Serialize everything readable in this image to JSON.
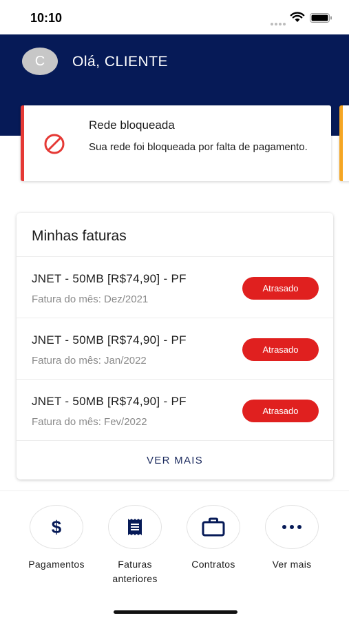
{
  "status_bar": {
    "time": "10:10"
  },
  "header": {
    "avatar_initial": "C",
    "greeting": "Olá, CLIENTE",
    "background": "#061a57"
  },
  "alert": {
    "title": "Rede bloqueada",
    "message": "Sua rede foi bloqueada por falta de pagamento.",
    "icon": "blocked-icon",
    "accent": "#e53935",
    "next_card_accent": "#f5a623"
  },
  "invoices": {
    "title": "Minhas faturas",
    "items": [
      {
        "name": "JNET - 50MB [R$74,90] - PF",
        "month": "Fatura do mês: Dez/2021",
        "status": "Atrasado"
      },
      {
        "name": "JNET - 50MB [R$74,90] - PF",
        "month": "Fatura do mês: Jan/2022",
        "status": "Atrasado"
      },
      {
        "name": "JNET - 50MB [R$74,90] - PF",
        "month": "Fatura do mês: Fev/2022",
        "status": "Atrasado"
      }
    ],
    "see_more": "VER MAIS",
    "status_color": "#e0201f"
  },
  "actions": [
    {
      "label": "Pagamentos",
      "icon": "dollar-icon"
    },
    {
      "label": "Faturas anteriores",
      "icon": "receipt-icon"
    },
    {
      "label": "Contratos",
      "icon": "briefcase-icon"
    },
    {
      "label": "Ver mais",
      "icon": "more-icon"
    }
  ]
}
